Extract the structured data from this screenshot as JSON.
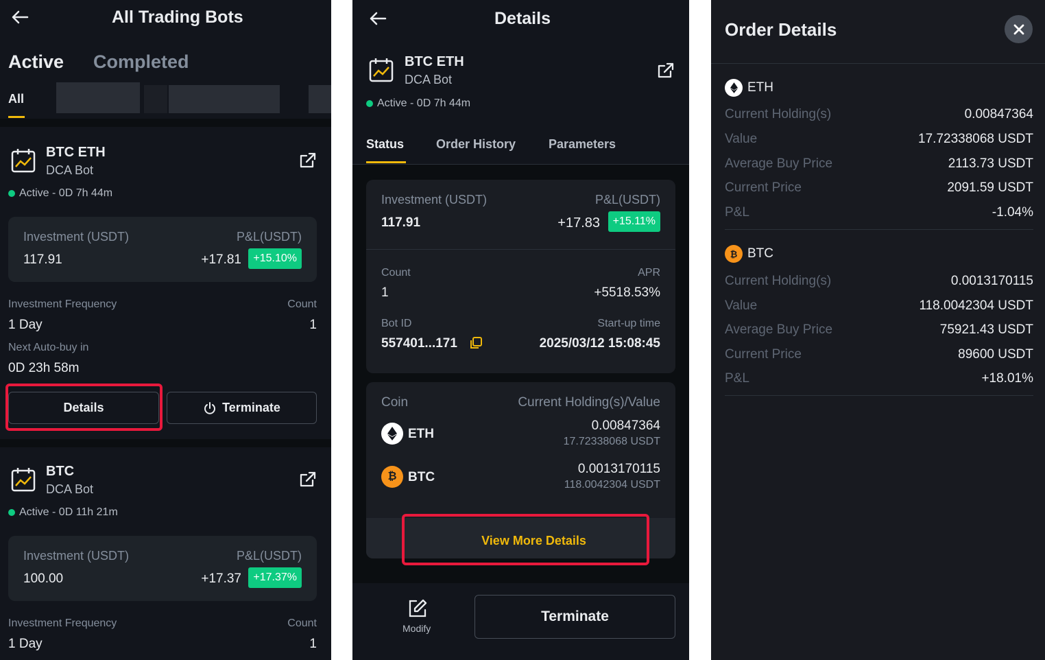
{
  "panel1": {
    "header_title": "All Trading Bots",
    "tabs": [
      "Active",
      "Completed"
    ],
    "filter_all": "All",
    "bots": [
      {
        "pair": "BTC ETH",
        "type": "DCA Bot",
        "status": "Active - 0D 7h 44m",
        "investment_label": "Investment (USDT)",
        "investment": "117.91",
        "pnl_label": "P&L(USDT)",
        "pnl": "+17.81",
        "pnl_pct": "+15.10%",
        "freq_label": "Investment Frequency",
        "freq": "1 Day",
        "count_label": "Count",
        "count": "1",
        "next_label": "Next Auto-buy in",
        "next": "0D 23h 58m",
        "details_btn": "Details",
        "terminate_btn": "Terminate"
      },
      {
        "pair": "BTC",
        "type": "DCA Bot",
        "status": "Active - 0D 11h 21m",
        "investment_label": "Investment (USDT)",
        "investment": "100.00",
        "pnl_label": "P&L(USDT)",
        "pnl": "+17.37",
        "pnl_pct": "+17.37%",
        "freq_label": "Investment Frequency",
        "freq": "1 Day",
        "count_label": "Count",
        "count": "1"
      }
    ]
  },
  "panel2": {
    "header_title": "Details",
    "pair": "BTC ETH",
    "type": "DCA Bot",
    "status": "Active - 0D 7h 44m",
    "tabs": [
      "Status",
      "Order History",
      "Parameters"
    ],
    "investment_label": "Investment (USDT)",
    "investment": "117.91",
    "pnl_label": "P&L(USDT)",
    "pnl": "+17.83",
    "pnl_pct": "+15.11%",
    "count_label": "Count",
    "count": "1",
    "apr_label": "APR",
    "apr": "+5518.53%",
    "botid_label": "Bot ID",
    "botid": "557401...171",
    "startup_label": "Start-up time",
    "startup": "2025/03/12 15:08:45",
    "coin_label": "Coin",
    "holding_label": "Current Holding(s)/Value",
    "coins": [
      {
        "name": "ETH",
        "amount": "0.00847364",
        "value": "17.72338068 USDT"
      },
      {
        "name": "BTC",
        "amount": "0.0013170115",
        "value": "118.0042304 USDT"
      }
    ],
    "view_more": "View More Details",
    "modify": "Modify",
    "terminate": "Terminate"
  },
  "panel3": {
    "title": "Order Details",
    "coins": [
      {
        "name": "ETH",
        "rows": [
          {
            "label": "Current Holding(s)",
            "value": "0.00847364"
          },
          {
            "label": "Value",
            "value": "17.72338068 USDT"
          },
          {
            "label": "Average Buy Price",
            "value": "2113.73 USDT"
          },
          {
            "label": "Current Price",
            "value": "2091.59 USDT"
          },
          {
            "label": "P&L",
            "value": "-1.04%"
          }
        ]
      },
      {
        "name": "BTC",
        "rows": [
          {
            "label": "Current Holding(s)",
            "value": "0.0013170115"
          },
          {
            "label": "Value",
            "value": "118.0042304 USDT"
          },
          {
            "label": "Average Buy Price",
            "value": "75921.43 USDT"
          },
          {
            "label": "Current Price",
            "value": "89600 USDT"
          },
          {
            "label": "P&L",
            "value": "+18.01%"
          }
        ]
      }
    ]
  },
  "colors": {
    "background": "#12151c",
    "green": "#0ecb81",
    "red": "#f6465d",
    "accent": "#f0b90b",
    "highlight": "#e8193c"
  },
  "icons": [
    "back-arrow-icon",
    "calendar-chart-icon",
    "external-link-icon",
    "power-icon",
    "copy-icon",
    "edit-icon",
    "close-icon",
    "eth-icon",
    "btc-icon"
  ]
}
